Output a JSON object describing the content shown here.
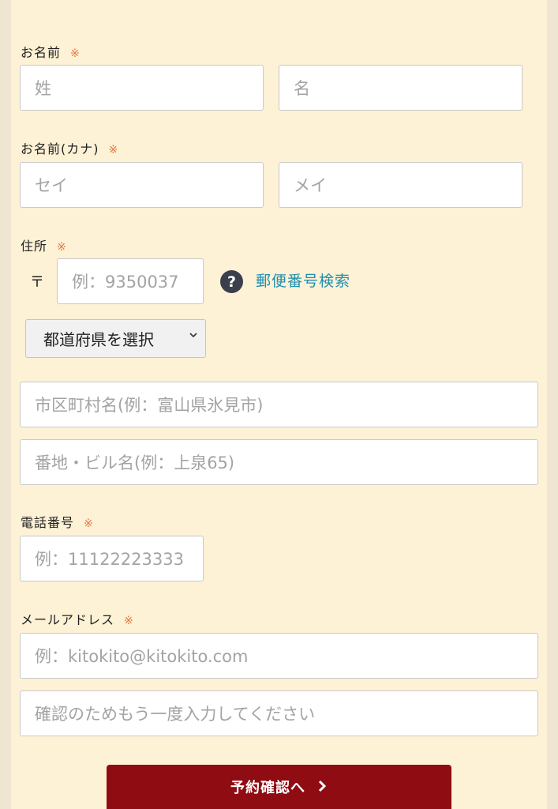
{
  "form": {
    "name": {
      "label": "お名前",
      "required_mark": "※",
      "last_placeholder": "姓",
      "first_placeholder": "名"
    },
    "kana": {
      "label": "お名前(カナ)",
      "required_mark": "※",
      "last_placeholder": "セイ",
      "first_placeholder": "メイ"
    },
    "address": {
      "label": "住所",
      "required_mark": "※",
      "zip_mark": "〒",
      "zip_placeholder": "例：9350037",
      "help_icon": "?",
      "zip_search_link": "郵便番号検索",
      "prefecture_select": "都道府県を選択",
      "city_placeholder": "市区町村名(例：富山県氷見市)",
      "street_placeholder": "番地・ビル名(例：上泉65)"
    },
    "phone": {
      "label": "電話番号",
      "required_mark": "※",
      "placeholder": "例：11122223333"
    },
    "email": {
      "label": "メールアドレス",
      "required_mark": "※",
      "placeholder": "例：kitokito@kitokito.com",
      "confirm_placeholder": "確認のためもう一度入力してください"
    },
    "submit": {
      "label": "予約確認へ",
      "icon": "chevron-right-icon"
    }
  }
}
